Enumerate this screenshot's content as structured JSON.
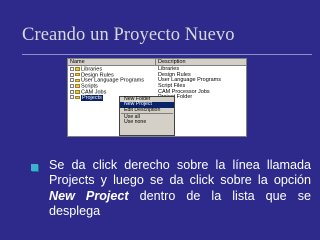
{
  "slide": {
    "title": "Creando un Proyecto Nuevo"
  },
  "screenshot": {
    "columns": {
      "name": "Name",
      "description": "Description"
    },
    "tree": [
      {
        "label": "Libraries",
        "description": "Libraries"
      },
      {
        "label": "Design Rules",
        "description": "Design Rules"
      },
      {
        "label": "User Language Programs",
        "description": "User Language Programs"
      },
      {
        "label": "Scripts",
        "description": "Script Files"
      },
      {
        "label": "CAM Jobs",
        "description": "CAM Processor Jobs"
      },
      {
        "label": "Projects",
        "description": "Project Folder",
        "selected": true
      }
    ],
    "context_menu": [
      {
        "label": "New Folder"
      },
      {
        "label": "New Project",
        "highlighted": true
      },
      {
        "label": "Edit Description"
      },
      {
        "separator": true
      },
      {
        "label": "Use all"
      },
      {
        "label": "Use none"
      }
    ]
  },
  "bullet": {
    "pre": "Se da click derecho sobre la línea llamada Projects y luego se da click sobre la opción ",
    "emphasis": "New Project",
    "post": " dentro de la lista que se desplega"
  },
  "colors": {
    "background": "#2d2a8c",
    "title": "#d8d8d8",
    "bullet": "#3cb0d0",
    "selection": "#0a246a"
  }
}
